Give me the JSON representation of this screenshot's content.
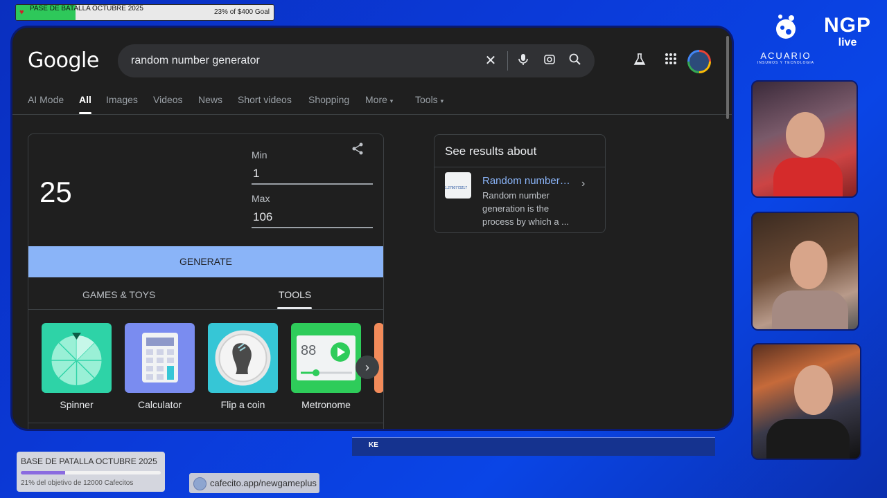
{
  "top_goal": {
    "title": "PASE DE BATALLA OCTUBRE 2025",
    "amount_text": "23% of $400 Goal",
    "progress_percent": 23
  },
  "browser": {
    "logo": "Google",
    "search_query": "random number generator",
    "icons": [
      "close-icon",
      "microphone-icon",
      "lens-icon",
      "search-icon",
      "labs-icon",
      "apps-grid-icon",
      "avatar"
    ],
    "tabs": [
      "AI Mode",
      "All",
      "Images",
      "Videos",
      "News",
      "Short videos",
      "Shopping",
      "More",
      "Tools"
    ],
    "active_tab": "All"
  },
  "rng": {
    "result": "25",
    "min_label": "Min",
    "min_value": "1",
    "max_label": "Max",
    "max_value": "106",
    "generate_label": "GENERATE",
    "subtabs": [
      "GAMES & TOYS",
      "TOOLS"
    ],
    "active_subtab": "TOOLS",
    "tools": [
      {
        "label": "Spinner",
        "color": "#2ed3a7"
      },
      {
        "label": "Calculator",
        "color": "#7a8cf0"
      },
      {
        "label": "Flip a coin",
        "color": "#36c6d6"
      },
      {
        "label": "Metronome",
        "color": "#2ecc5a"
      }
    ],
    "metronome_bpm": "88"
  },
  "results_about": {
    "heading": "See results about",
    "title": "Random number…",
    "description": "Random number generation is the process by which a ...",
    "thumb_number": "1.2760773217"
  },
  "stream": {
    "brand1_name": "ACUARIO",
    "brand1_tag": "INSUMOS Y TECNOLOGIA",
    "brand2_a": "NGP",
    "brand2_b": "live",
    "bottom_goal_title": "BASE DE PATALLA OCTUBRE 2025",
    "bottom_goal_subtitle": "21% del objetivo de 12000 Cafecitos",
    "bottom_goal_progress_percent": 21,
    "cafecito_url": "cafecito.app/newgameplus",
    "ticker_text": "KE"
  }
}
